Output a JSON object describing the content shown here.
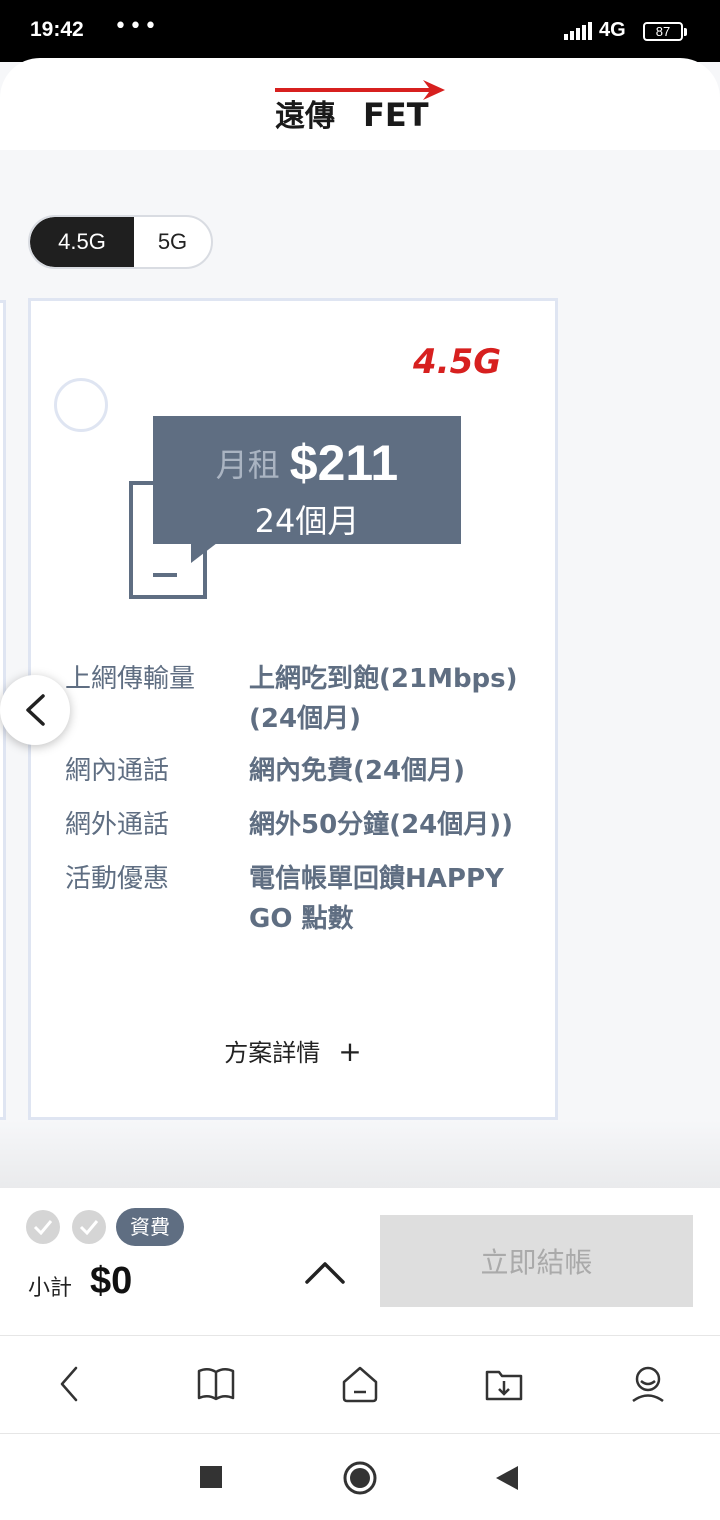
{
  "status_bar": {
    "time": "19:42",
    "dots": "•••",
    "network": "4G",
    "battery": "87"
  },
  "header": {
    "logo_text_cn": "遠傳",
    "logo_text_en": "FET",
    "logo_color": "#d7201f"
  },
  "network_toggle": {
    "options": [
      "4.5G",
      "5G"
    ],
    "selected": "4.5G"
  },
  "plan_card": {
    "badge": "4.5G",
    "price_label": "月租",
    "price": "$211",
    "term": "24個月",
    "features": [
      {
        "label": "上網傳輸量",
        "value": "上網吃到飽(21Mbps)(24個月)"
      },
      {
        "label": "網內通話",
        "value": "網內免費(24個月)"
      },
      {
        "label": "網外通話",
        "value": "網外50分鐘(24個月))"
      },
      {
        "label": "活動優惠",
        "value": "電信帳單回饋HAPPY GO 點數"
      }
    ],
    "details_link": "方案詳情",
    "details_plus": "+"
  },
  "checkout_bar": {
    "fee_badge": "資費",
    "subtotal_label": "小計",
    "subtotal_value": "$0",
    "checkout_label": "立即結帳"
  },
  "colors": {
    "card_accent": "#5f6e82",
    "brand_red": "#d7201f",
    "disabled_button": "#dedede"
  },
  "browser_nav": {
    "icons": [
      "back-icon",
      "bookmarks-icon",
      "home-icon",
      "downloads-icon",
      "profile-icon"
    ]
  },
  "system_nav": {
    "icons": [
      "recent-apps-icon",
      "home-circle-icon",
      "back-triangle-icon"
    ]
  }
}
